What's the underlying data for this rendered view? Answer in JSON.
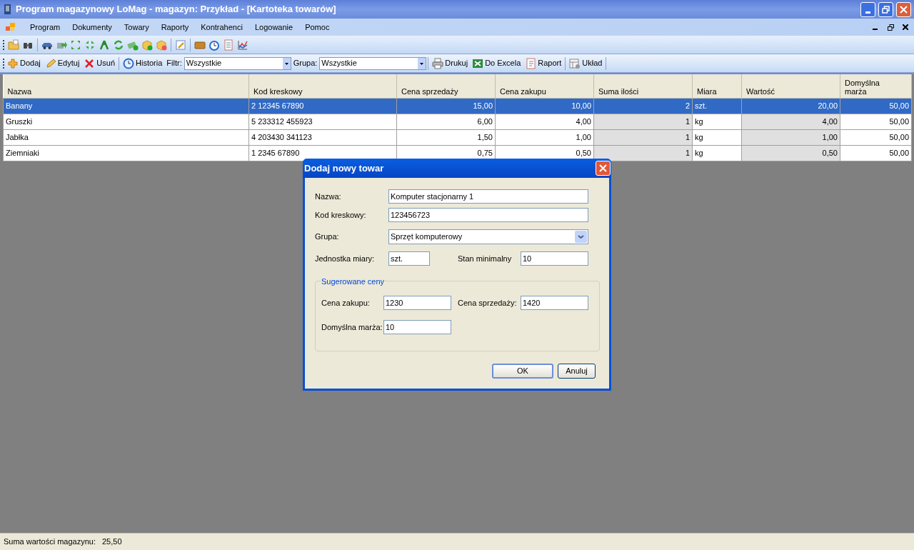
{
  "window": {
    "title": "Program magazynowy LoMag - magazyn: Przykład - [Kartoteka towarów]"
  },
  "menu": [
    "Program",
    "Dokumenty",
    "Towary",
    "Raporty",
    "Kontrahenci",
    "Logowanie",
    "Pomoc"
  ],
  "toolbar": {
    "groups": [
      [
        {
          "kind": "button",
          "label": "Dodaj"
        },
        {
          "kind": "button",
          "label": "Edytuj"
        },
        {
          "kind": "button",
          "label": "Usuń"
        }
      ],
      [
        {
          "kind": "button",
          "label": "Historia"
        },
        {
          "kind": "label",
          "label": "Filtr:"
        },
        {
          "kind": "combo",
          "value": "Wszystkie"
        },
        {
          "kind": "label",
          "label": "Grupa:"
        },
        {
          "kind": "combo",
          "value": "Wszystkie"
        }
      ],
      [
        {
          "kind": "button",
          "label": "Drukuj"
        },
        {
          "kind": "button",
          "label": "Do Excela"
        },
        {
          "kind": "button",
          "label": "Raport"
        }
      ],
      [
        {
          "kind": "button",
          "label": "Układ"
        }
      ]
    ]
  },
  "table": {
    "columns": [
      {
        "label": "Nazwa",
        "kind": "text",
        "shaded": false
      },
      {
        "label": "Kod kreskowy",
        "kind": "text",
        "shaded": false
      },
      {
        "label": "Cena sprzedaży",
        "kind": "number",
        "shaded": false
      },
      {
        "label": "Cena zakupu",
        "kind": "number",
        "shaded": false
      },
      {
        "label": "Suma ilości",
        "kind": "number",
        "shaded": true
      },
      {
        "label": "Miara",
        "kind": "text",
        "shaded": false
      },
      {
        "label": "Wartość",
        "kind": "number",
        "shaded": true
      },
      {
        "label": "Domyślna marża",
        "kind": "number",
        "shaded": false
      }
    ],
    "rows": [
      {
        "selected": true,
        "cells": [
          "Banany",
          "2 12345 67890",
          "15,00",
          "10,00",
          "2",
          "szt.",
          "20,00",
          "50,00"
        ]
      },
      {
        "selected": false,
        "cells": [
          "Gruszki",
          "5 233312 455923",
          "6,00",
          "4,00",
          "1",
          "kg",
          "4,00",
          "50,00"
        ]
      },
      {
        "selected": false,
        "cells": [
          "Jabłka",
          "4 203430 341123",
          "1,50",
          "1,00",
          "1",
          "kg",
          "1,00",
          "50,00"
        ]
      },
      {
        "selected": false,
        "cells": [
          "Ziemniaki",
          "1 2345 67890",
          "0,75",
          "0,50",
          "1",
          "kg",
          "0,50",
          "50,00"
        ]
      }
    ]
  },
  "dialog": {
    "title": "Dodaj nowy towar",
    "name": {
      "label": "Nazwa:",
      "value": "Komputer stacjonarny 1"
    },
    "barcode": {
      "label": "Kod kreskowy:",
      "value": "123456723"
    },
    "group": {
      "label": "Grupa:",
      "value": "Sprzęt komputerowy"
    },
    "unit": {
      "label": "Jednostka miary:",
      "value": "szt."
    },
    "min_stock": {
      "label": "Stan minimalny",
      "value": "10"
    },
    "prices": {
      "legend": "Sugerowane ceny",
      "purchase": {
        "label": "Cena zakupu:",
        "value": "1230"
      },
      "sale": {
        "label": "Cena sprzedaży:",
        "value": "1420"
      },
      "margin": {
        "label": "Domyślna marża:",
        "value": "10"
      }
    },
    "buttons": [
      {
        "label": "OK",
        "default": true
      },
      {
        "label": "Anuluj",
        "default": false
      }
    ]
  },
  "status_bar": {
    "label": "Suma wartości magazynu:",
    "value": "25,50"
  }
}
